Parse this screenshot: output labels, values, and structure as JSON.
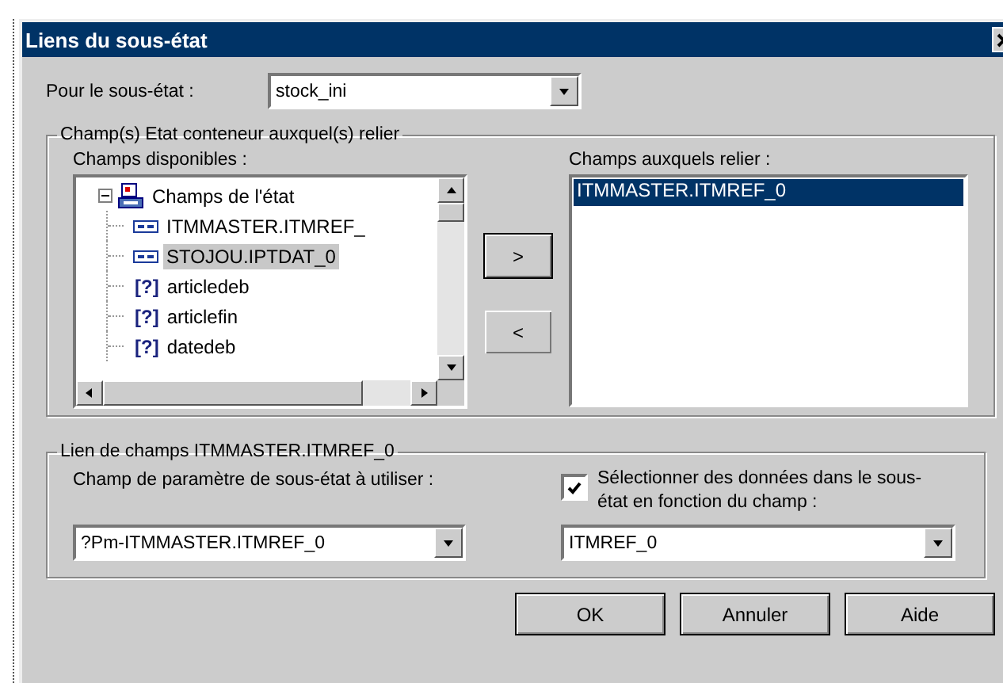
{
  "window": {
    "title": "Liens du sous-état"
  },
  "subreport": {
    "label": "Pour le sous-état :",
    "value": "stock_ini"
  },
  "container_group": {
    "legend": "Champ(s) Etat conteneur auxquel(s) relier",
    "available": {
      "label": "Champs disponibles :",
      "tree": [
        {
          "label": "Champs de l'état",
          "kind": "folder",
          "expanded": true,
          "selected": false,
          "children": [
            {
              "label": "ITMMASTER.ITMREF_",
              "kind": "field",
              "selected": false
            },
            {
              "label": "STOJOU.IPTDAT_0",
              "kind": "field",
              "selected": true
            },
            {
              "label": "articledeb",
              "kind": "parameter",
              "badge": "[?]",
              "selected": false
            },
            {
              "label": "articlefin",
              "kind": "parameter",
              "badge": "[?]",
              "selected": false
            },
            {
              "label": "datedeb",
              "kind": "parameter",
              "badge": "[?]",
              "selected": false
            }
          ]
        }
      ]
    },
    "move_buttons": [
      {
        "label": ">",
        "default": true
      },
      {
        "label": "<",
        "default": false
      }
    ],
    "linked": {
      "label": "Champs auxquels relier :",
      "items": [
        {
          "label": "ITMMASTER.ITMREF_0",
          "selected": true
        }
      ]
    }
  },
  "link_group": {
    "legend": "Lien de champs ITMMASTER.ITMREF_0",
    "parameter": {
      "label": "Champ de paramètre de sous-état à utiliser :",
      "value": "?Pm-ITMMASTER.ITMREF_0"
    },
    "filter": {
      "label": "Sélectionner des données dans le sous-état en fonction du champ :",
      "checked": true,
      "value": "ITMREF_0"
    }
  },
  "buttons": [
    "OK",
    "Annuler",
    "Aide"
  ]
}
